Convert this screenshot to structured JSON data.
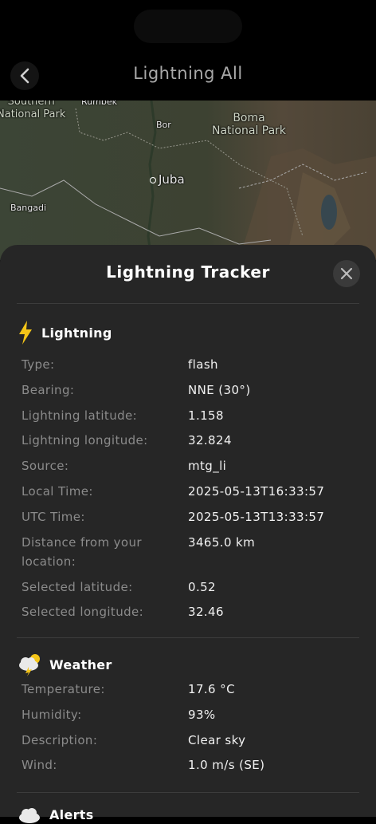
{
  "header": {
    "title": "Lightning All"
  },
  "map": {
    "labels": {
      "southern_park": "Southern\nNational Park",
      "rumbek": "Rumbek",
      "bor": "Bor",
      "boma": "Boma\nNational Park",
      "juba": "Juba",
      "bangadi": "Bangadi"
    }
  },
  "sheet": {
    "title": "Lightning Tracker",
    "lightning": {
      "heading": "Lightning",
      "icon": "lightning-bolt-icon",
      "rows": [
        {
          "k": "Type:",
          "v": "flash"
        },
        {
          "k": "Bearing:",
          "v": "NNE (30°)"
        },
        {
          "k": "Lightning latitude:",
          "v": "1.158"
        },
        {
          "k": "Lightning longitude:",
          "v": "32.824"
        },
        {
          "k": "Source:",
          "v": "mtg_li"
        },
        {
          "k": "Local Time:",
          "v": "2025-05-13T16:33:57"
        },
        {
          "k": "UTC Time:",
          "v": "2025-05-13T13:33:57"
        },
        {
          "k": "Distance from your location:",
          "v": "3465.0 km"
        },
        {
          "k": "Selected latitude:",
          "v": "0.52"
        },
        {
          "k": "Selected longitude:",
          "v": "32.46"
        }
      ]
    },
    "weather": {
      "heading": "Weather",
      "icon": "thunder-cloud-sun-icon",
      "rows": [
        {
          "k": "Temperature:",
          "v": "17.6 °C"
        },
        {
          "k": "Humidity:",
          "v": "93%"
        },
        {
          "k": "Description:",
          "v": "Clear sky"
        },
        {
          "k": "Wind:",
          "v": "1.0 m/s (SE)"
        }
      ]
    },
    "alerts": {
      "heading": "Alerts",
      "icon": "cloud-icon"
    }
  },
  "colors": {
    "sheet_bg": "#262626",
    "accent_yellow": "#f5c518",
    "label_grey": "#8b8b8b"
  }
}
